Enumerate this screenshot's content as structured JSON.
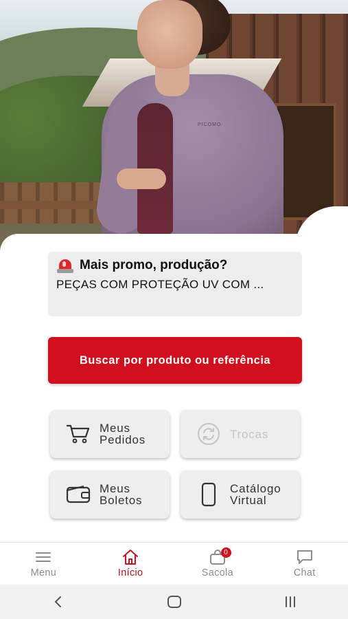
{
  "promo": {
    "title": "Mais promo, produção?",
    "subtitle": "PEÇAS COM PROTEÇÃO UV COM ...",
    "icon": "siren-icon"
  },
  "search": {
    "label": "Buscar por produto ou referência"
  },
  "tiles": [
    {
      "line1": "Meus",
      "line2": "Pedidos",
      "icon": "cart-icon",
      "enabled": true
    },
    {
      "line1": "Trocas",
      "line2": "",
      "icon": "exchange-icon",
      "enabled": false
    },
    {
      "line1": "Meus",
      "line2": "Boletos",
      "icon": "wallet-icon",
      "enabled": true
    },
    {
      "line1": "Catálogo",
      "line2": "Virtual",
      "icon": "phone-icon",
      "enabled": true
    }
  ],
  "bottom_nav": {
    "items": [
      {
        "label": "Menu",
        "icon": "hamburger-icon",
        "active": false
      },
      {
        "label": "Início",
        "icon": "home-icon",
        "active": true
      },
      {
        "label": "Sacola",
        "icon": "bag-icon",
        "active": false,
        "badge": "0"
      },
      {
        "label": "Chat",
        "icon": "chat-icon",
        "active": false
      }
    ]
  },
  "hero": {
    "logo_text": "PICOMO"
  },
  "colors": {
    "accent": "#d20f1e",
    "tile_bg": "#eeeeee",
    "card_bg": "#ededed",
    "inactive": "#8c8c8c"
  }
}
